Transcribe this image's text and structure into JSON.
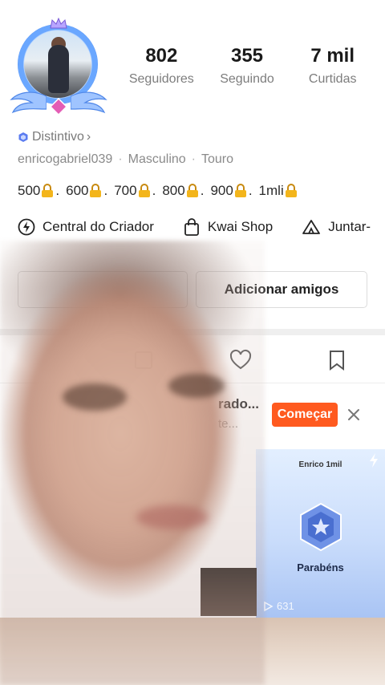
{
  "profile": {
    "stats": [
      {
        "value": "802",
        "label": "Seguidores"
      },
      {
        "value": "355",
        "label": "Seguindo"
      },
      {
        "value": "7 mil",
        "label": "Curtidas"
      }
    ],
    "badge_label": "Distintivo",
    "badge_chevron": "›",
    "username": "enricogabriel039",
    "gender": "Masculino",
    "zodiac": "Touro",
    "info_separator": "·",
    "bio_items": [
      "500",
      "600",
      "700",
      "800",
      "900",
      "1mli"
    ],
    "bio_separator": "."
  },
  "creator_links": {
    "creator_center": "Central do Criador",
    "shop": "Kwai Shop",
    "join": "Juntar-"
  },
  "buttons": {
    "edit_profile": "",
    "add_friends": "Adicionar amigos"
  },
  "banner": {
    "title": "rado...",
    "subtitle": "te...",
    "start_button": "Começar",
    "close_icon": "×"
  },
  "thumbnail": {
    "header": "Enrico 1mil",
    "title": "Parabéns",
    "plays": "631"
  },
  "colors": {
    "accent": "#ff5a1f",
    "badge_blue": "#5b7cf0",
    "lock_yellow": "#f3b51b"
  }
}
